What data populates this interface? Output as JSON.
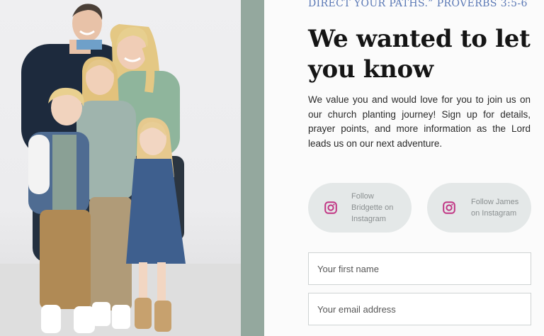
{
  "photo": {
    "alt": "Family portrait"
  },
  "quote": {
    "tail": "DIRECT YOUR PATHS.” PROVERBS 3:5-6"
  },
  "heading": "We wanted to let you know",
  "body": "We value you and would love for you to join us on our church planting journey! Sign up for details, prayer points, and more information as the Lord leads us on our next adventure.",
  "social": {
    "bridgette": {
      "label": "Follow Bridgette on Instagram",
      "icon": "instagram-icon"
    },
    "james": {
      "label": "Follow James on Instagram",
      "icon": "instagram-icon"
    }
  },
  "form": {
    "first_name_placeholder": "Your first name",
    "email_placeholder": "Your email address"
  },
  "colors": {
    "sage": "#94a89e",
    "quote_blue": "#5a78b5",
    "instagram": "#c13584",
    "pill_bg": "#e4e8e8"
  }
}
